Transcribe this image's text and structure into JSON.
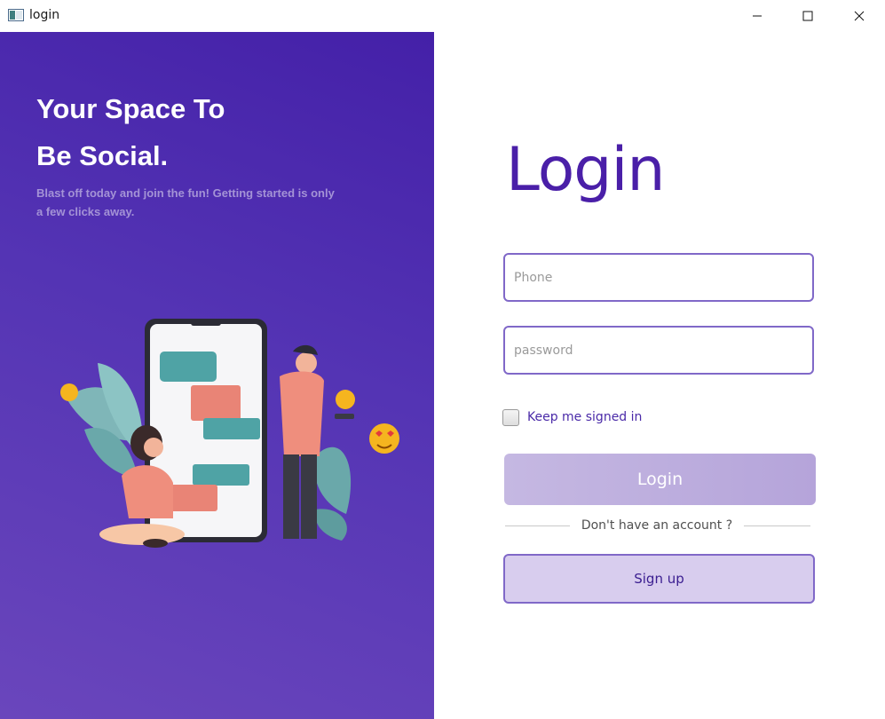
{
  "window": {
    "title": "login",
    "controls": [
      "minimize-icon",
      "maximize-icon",
      "close-icon"
    ]
  },
  "hero": {
    "headline_line1": "Your Space To",
    "headline_line2": "Be Social.",
    "subtext": "Blast off today and join the fun! Getting started is only a few clicks away."
  },
  "form": {
    "heading": "Login",
    "phone_placeholder": "Phone",
    "phone_value": "",
    "password_placeholder": "password",
    "password_value": "",
    "keep_signed_in_label": "Keep me signed in",
    "keep_signed_in_checked": false,
    "login_button_label": "Login",
    "divider_text": "Don't have an account ?",
    "signup_button_label": "Sign up"
  },
  "colors": {
    "brand_purple": "#4a1fa8",
    "panel_gradient_start": "#4420a8",
    "panel_gradient_end": "#6a46bc",
    "field_border": "#8068c8",
    "login_button_bg": "#bfb1e0",
    "signup_button_bg": "#d8cdee"
  }
}
